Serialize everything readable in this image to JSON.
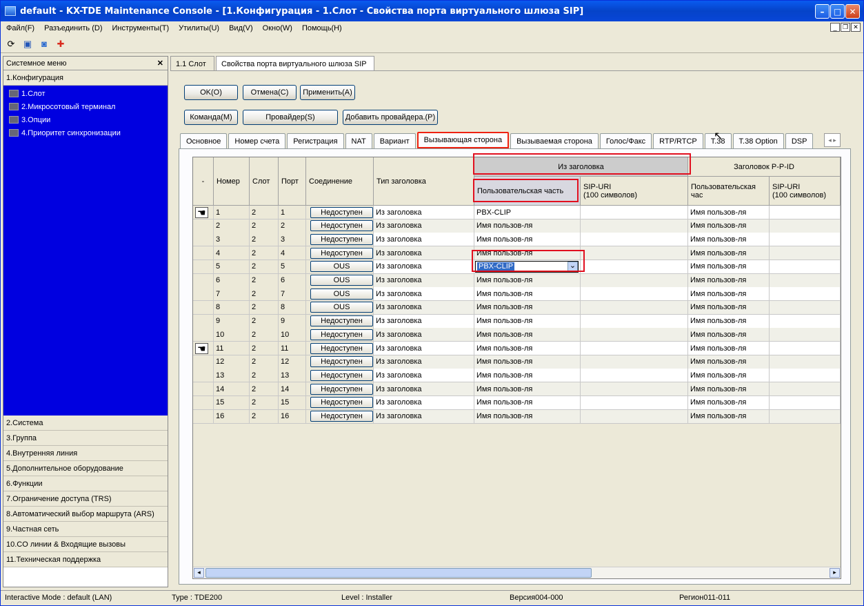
{
  "window": {
    "title": "default - KX-TDE Maintenance Console - [1.Конфигурация - 1.Слот - Свойства порта виртуального шлюза SIP]"
  },
  "menu": [
    "Файл(F)",
    "Разъединить (D)",
    "Инструменты(T)",
    "Утилиты(U)",
    "Вид(V)",
    "Окно(W)",
    "Помощь(H)"
  ],
  "sidebar": {
    "title": "Системное меню",
    "active_section": "1.Конфигурация",
    "tree": [
      "1.Слот",
      "2.Микросотовый терминал",
      "3.Опции",
      "4.Приоритет синхронизации"
    ],
    "sections": [
      "2.Система",
      "3.Группа",
      "4.Внутренняя линия",
      "5.Дополнительное оборудование",
      "6.Функции",
      "7.Ограничение доступа (TRS)",
      "8.Автоматический выбор маршрута (ARS)",
      "9.Частная сеть",
      "10.CO линии & Входящие вызовы",
      "11.Техническая поддержка"
    ]
  },
  "window_tabs": [
    "1.1 Слот",
    "Свойства порта виртуального шлюза SIP"
  ],
  "buttons": {
    "ok": "OK(O)",
    "cancel": "Отмена(C)",
    "apply": "Применить(A)",
    "command": "Команда(M)",
    "provider": "Провайдер(S)",
    "add_provider": "Добавить провайдера.(P)"
  },
  "tabs": [
    "Основное",
    "Номер счета",
    "Регистрация",
    "NAT",
    "Вариант",
    "Вызывающая сторона",
    "Вызываемая сторона",
    "Голос/Факс",
    "RTP/RTCP",
    "T.38",
    "T.38 Option",
    "DSP"
  ],
  "active_tab": "Вызывающая сторона",
  "headers": {
    "dash": "-",
    "num": "Номер",
    "slot": "Слот",
    "port": "Порт",
    "conn": "Соединение",
    "type": "Тип заголовка",
    "from": "Из заголовка",
    "user_part": "Пользовательская часть",
    "sip_uri": "SIP-URI",
    "sip_uri2": "(100 символов)",
    "ppid": "Заголовок P-P-ID",
    "user_part2": "Пользовательская час",
    "sip_uri_b": "SIP-URI",
    "sip_uri_b2": "(100 символов)"
  },
  "rows": [
    [
      "1",
      "2",
      "1",
      "Недоступен",
      "Из заголовка",
      "PBX-CLIP",
      "Имя пользов-ля"
    ],
    [
      "2",
      "2",
      "2",
      "Недоступен",
      "Из заголовка",
      "Имя пользов-ля",
      "Имя пользов-ля"
    ],
    [
      "3",
      "2",
      "3",
      "Недоступен",
      "Из заголовка",
      "Имя пользов-ля",
      "Имя пользов-ля"
    ],
    [
      "4",
      "2",
      "4",
      "Недоступен",
      "Из заголовка",
      "Имя пользов-ля",
      "Имя пользов-ля"
    ],
    [
      "5",
      "2",
      "5",
      "OUS",
      "Из заголовка",
      "PBX-CLIP",
      "Имя пользов-ля"
    ],
    [
      "6",
      "2",
      "6",
      "OUS",
      "Из заголовка",
      "Имя пользов-ля",
      "Имя пользов-ля"
    ],
    [
      "7",
      "2",
      "7",
      "OUS",
      "Из заголовка",
      "Имя пользов-ля",
      "Имя пользов-ля"
    ],
    [
      "8",
      "2",
      "8",
      "OUS",
      "Из заголовка",
      "Имя пользов-ля",
      "Имя пользов-ля"
    ],
    [
      "9",
      "2",
      "9",
      "Недоступен",
      "Из заголовка",
      "Имя пользов-ля",
      "Имя пользов-ля"
    ],
    [
      "10",
      "2",
      "10",
      "Недоступен",
      "Из заголовка",
      "Имя пользов-ля",
      "Имя пользов-ля"
    ],
    [
      "11",
      "2",
      "11",
      "Недоступен",
      "Из заголовка",
      "Имя пользов-ля",
      "Имя пользов-ля"
    ],
    [
      "12",
      "2",
      "12",
      "Недоступен",
      "Из заголовка",
      "Имя пользов-ля",
      "Имя пользов-ля"
    ],
    [
      "13",
      "2",
      "13",
      "Недоступен",
      "Из заголовка",
      "Имя пользов-ля",
      "Имя пользов-ля"
    ],
    [
      "14",
      "2",
      "14",
      "Недоступен",
      "Из заголовка",
      "Имя пользов-ля",
      "Имя пользов-ля"
    ],
    [
      "15",
      "2",
      "15",
      "Недоступен",
      "Из заголовка",
      "Имя пользов-ля",
      "Имя пользов-ля"
    ],
    [
      "16",
      "2",
      "16",
      "Недоступен",
      "Из заголовка",
      "Имя пользов-ля",
      "Имя пользов-ля"
    ]
  ],
  "status": {
    "mode": "Interactive Mode : default (LAN)",
    "type": "Type : TDE200",
    "level": "Level : Installer",
    "version": "Версия004-000",
    "region": "Регион011-011"
  },
  "colors": {
    "tree_bg": "#0000e0",
    "highlight": "#e10f1f"
  }
}
